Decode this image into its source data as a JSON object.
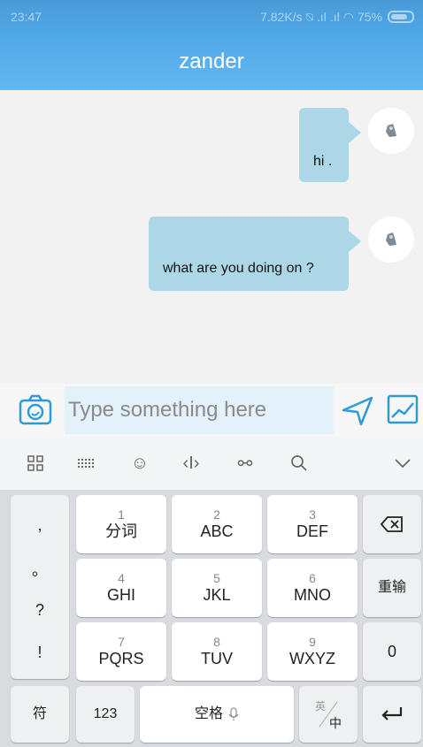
{
  "status": {
    "time": "23:47",
    "speed": "7.82K/s",
    "battery": "75%"
  },
  "header": {
    "title": "zander"
  },
  "messages": [
    {
      "text": "hi ."
    },
    {
      "text": "what are you doing on ?"
    }
  ],
  "input": {
    "placeholder": "Type something here"
  },
  "keyboard": {
    "punct": [
      ",",
      "。",
      "?",
      "!"
    ],
    "row1": [
      {
        "num": "1",
        "label": "分词"
      },
      {
        "num": "2",
        "label": "ABC"
      },
      {
        "num": "3",
        "label": "DEF"
      }
    ],
    "row2": [
      {
        "num": "4",
        "label": "GHI"
      },
      {
        "num": "5",
        "label": "JKL"
      },
      {
        "num": "6",
        "label": "MNO"
      }
    ],
    "row3": [
      {
        "num": "7",
        "label": "PQRS"
      },
      {
        "num": "8",
        "label": "TUV"
      },
      {
        "num": "9",
        "label": "WXYZ"
      }
    ],
    "reenter": "重输",
    "zero": "0",
    "symbols": "符",
    "numbers": "123",
    "space": "空格",
    "lang_top": "英",
    "lang_bottom": "中"
  },
  "colors": {
    "accent": "#4fa7e6",
    "bubble": "#acd7e6"
  }
}
